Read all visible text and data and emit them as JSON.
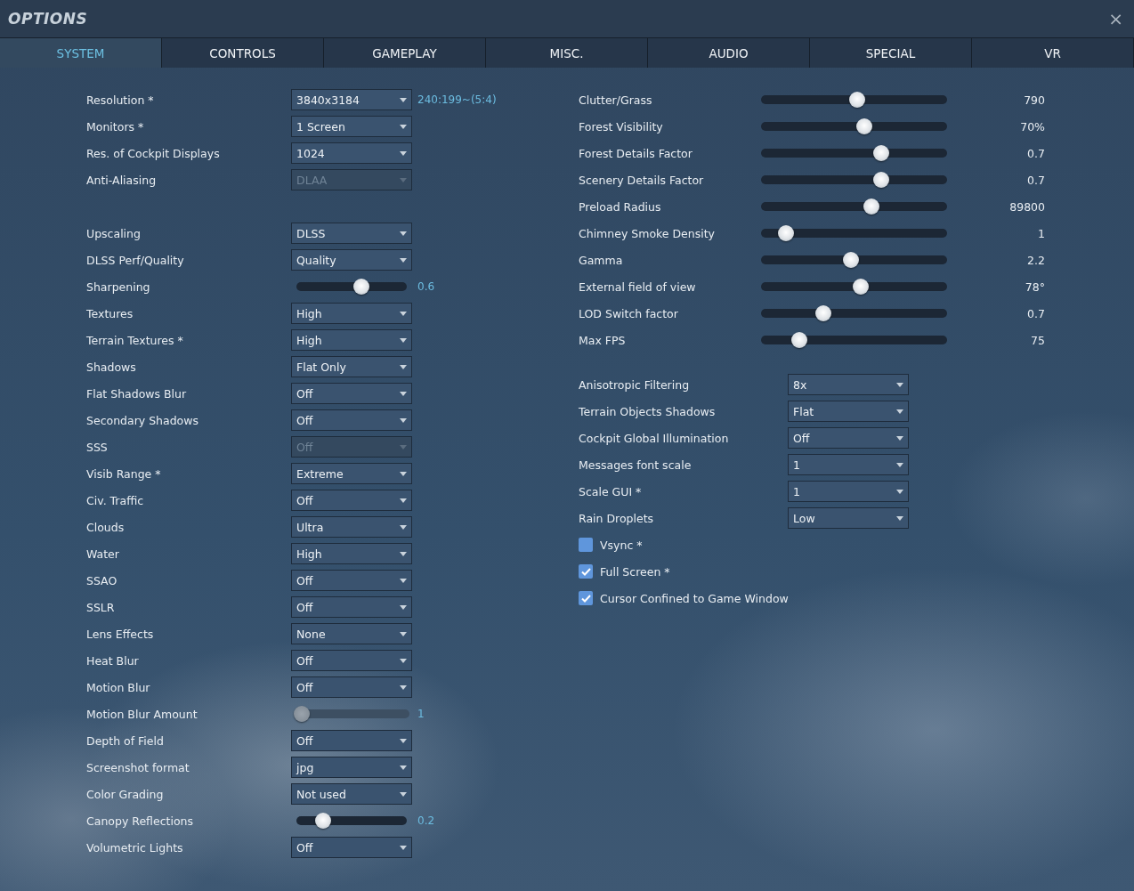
{
  "window": {
    "title": "OPTIONS",
    "close": "×"
  },
  "tabs": [
    {
      "label": "SYSTEM",
      "selected": true
    },
    {
      "label": "CONTROLS",
      "selected": false
    },
    {
      "label": "GAMEPLAY",
      "selected": false
    },
    {
      "label": "MISC.",
      "selected": false
    },
    {
      "label": "AUDIO",
      "selected": false
    },
    {
      "label": "SPECIAL",
      "selected": false
    },
    {
      "label": "VR",
      "selected": false
    }
  ],
  "left_groups": [
    [
      {
        "kind": "dropdown",
        "label": "Resolution *",
        "value": "3840x3184",
        "note": "240:199~(5:4)",
        "disabled": false
      },
      {
        "kind": "dropdown",
        "label": "Monitors *",
        "value": "1 Screen",
        "disabled": false
      },
      {
        "kind": "dropdown",
        "label": "Res. of Cockpit Displays",
        "value": "1024",
        "disabled": false
      },
      {
        "kind": "dropdown",
        "label": "Anti-Aliasing",
        "value": "DLAA",
        "disabled": true
      }
    ],
    [
      {
        "kind": "dropdown",
        "label": "Upscaling",
        "value": "DLSS",
        "disabled": false
      },
      {
        "kind": "dropdown",
        "label": "DLSS Perf/Quality",
        "value": "Quality",
        "disabled": false
      },
      {
        "kind": "slider",
        "label": "Sharpening",
        "level": 0.6,
        "reading": "0.6",
        "disabled": false
      },
      {
        "kind": "dropdown",
        "label": "Textures",
        "value": "High",
        "disabled": false
      },
      {
        "kind": "dropdown",
        "label": "Terrain Textures *",
        "value": "High",
        "disabled": false
      },
      {
        "kind": "dropdown",
        "label": "Shadows",
        "value": "Flat Only",
        "disabled": false
      },
      {
        "kind": "dropdown",
        "label": "Flat Shadows Blur",
        "value": "Off",
        "disabled": false
      },
      {
        "kind": "dropdown",
        "label": "Secondary Shadows",
        "value": "Off",
        "disabled": false
      },
      {
        "kind": "dropdown",
        "label": "SSS",
        "value": "Off",
        "disabled": true
      },
      {
        "kind": "dropdown",
        "label": "Visib Range *",
        "value": "Extreme",
        "disabled": false
      },
      {
        "kind": "dropdown",
        "label": "Civ. Traffic",
        "value": "Off",
        "disabled": false
      },
      {
        "kind": "dropdown",
        "label": "Clouds",
        "value": "Ultra",
        "disabled": false
      },
      {
        "kind": "dropdown",
        "label": "Water",
        "value": "High",
        "disabled": false
      },
      {
        "kind": "dropdown",
        "label": "SSAO",
        "value": "Off",
        "disabled": false
      },
      {
        "kind": "dropdown",
        "label": "SSLR",
        "value": "Off",
        "disabled": false
      },
      {
        "kind": "dropdown",
        "label": "Lens Effects",
        "value": "None",
        "disabled": false
      },
      {
        "kind": "dropdown",
        "label": "Heat Blur",
        "value": "Off",
        "disabled": false
      },
      {
        "kind": "dropdown",
        "label": "Motion Blur",
        "value": "Off",
        "disabled": false
      },
      {
        "kind": "slider",
        "label": "Motion Blur Amount",
        "level": 0,
        "reading": "1",
        "disabled": true
      },
      {
        "kind": "dropdown",
        "label": "Depth of Field",
        "value": "Off",
        "disabled": false
      },
      {
        "kind": "dropdown",
        "label": "Screenshot format",
        "value": "jpg",
        "disabled": false
      },
      {
        "kind": "dropdown",
        "label": "Color Grading",
        "value": "Not used",
        "disabled": false
      },
      {
        "kind": "slider",
        "label": "Canopy Reflections",
        "level": 0.2,
        "reading": "0.2",
        "disabled": false
      },
      {
        "kind": "dropdown",
        "label": "Volumetric Lights",
        "value": "Off",
        "disabled": false
      }
    ]
  ],
  "right_sliders": [
    {
      "label": "Clutter/Grass",
      "level": 0.52,
      "reading": "790"
    },
    {
      "label": "Forest Visibility",
      "level": 0.56,
      "reading": "70%"
    },
    {
      "label": "Forest Details Factor",
      "level": 0.66,
      "reading": "0.7"
    },
    {
      "label": "Scenery Details Factor",
      "level": 0.66,
      "reading": "0.7"
    },
    {
      "label": "Preload Radius",
      "level": 0.6,
      "reading": "89800"
    },
    {
      "label": "Chimney Smoke Density",
      "level": 0.1,
      "reading": "1"
    },
    {
      "label": "Gamma",
      "level": 0.48,
      "reading": "2.2"
    },
    {
      "label": "External field of view",
      "level": 0.54,
      "reading": "78°"
    },
    {
      "label": "LOD Switch factor",
      "level": 0.32,
      "reading": "0.7"
    },
    {
      "label": "Max FPS",
      "level": 0.18,
      "reading": "75"
    }
  ],
  "right_dropdowns": [
    {
      "label": "Anisotropic Filtering",
      "value": "8x"
    },
    {
      "label": "Terrain Objects Shadows",
      "value": "Flat"
    },
    {
      "label": "Cockpit Global Illumination",
      "value": "Off"
    },
    {
      "label": "Messages font scale",
      "value": "1"
    },
    {
      "label": "Scale GUI *",
      "value": "1"
    },
    {
      "label": "Rain Droplets",
      "value": "Low"
    }
  ],
  "checkboxes": [
    {
      "label": "Vsync *",
      "checked": false
    },
    {
      "label": "Full Screen *",
      "checked": true
    },
    {
      "label": "Cursor Confined to Game Window",
      "checked": true
    }
  ]
}
